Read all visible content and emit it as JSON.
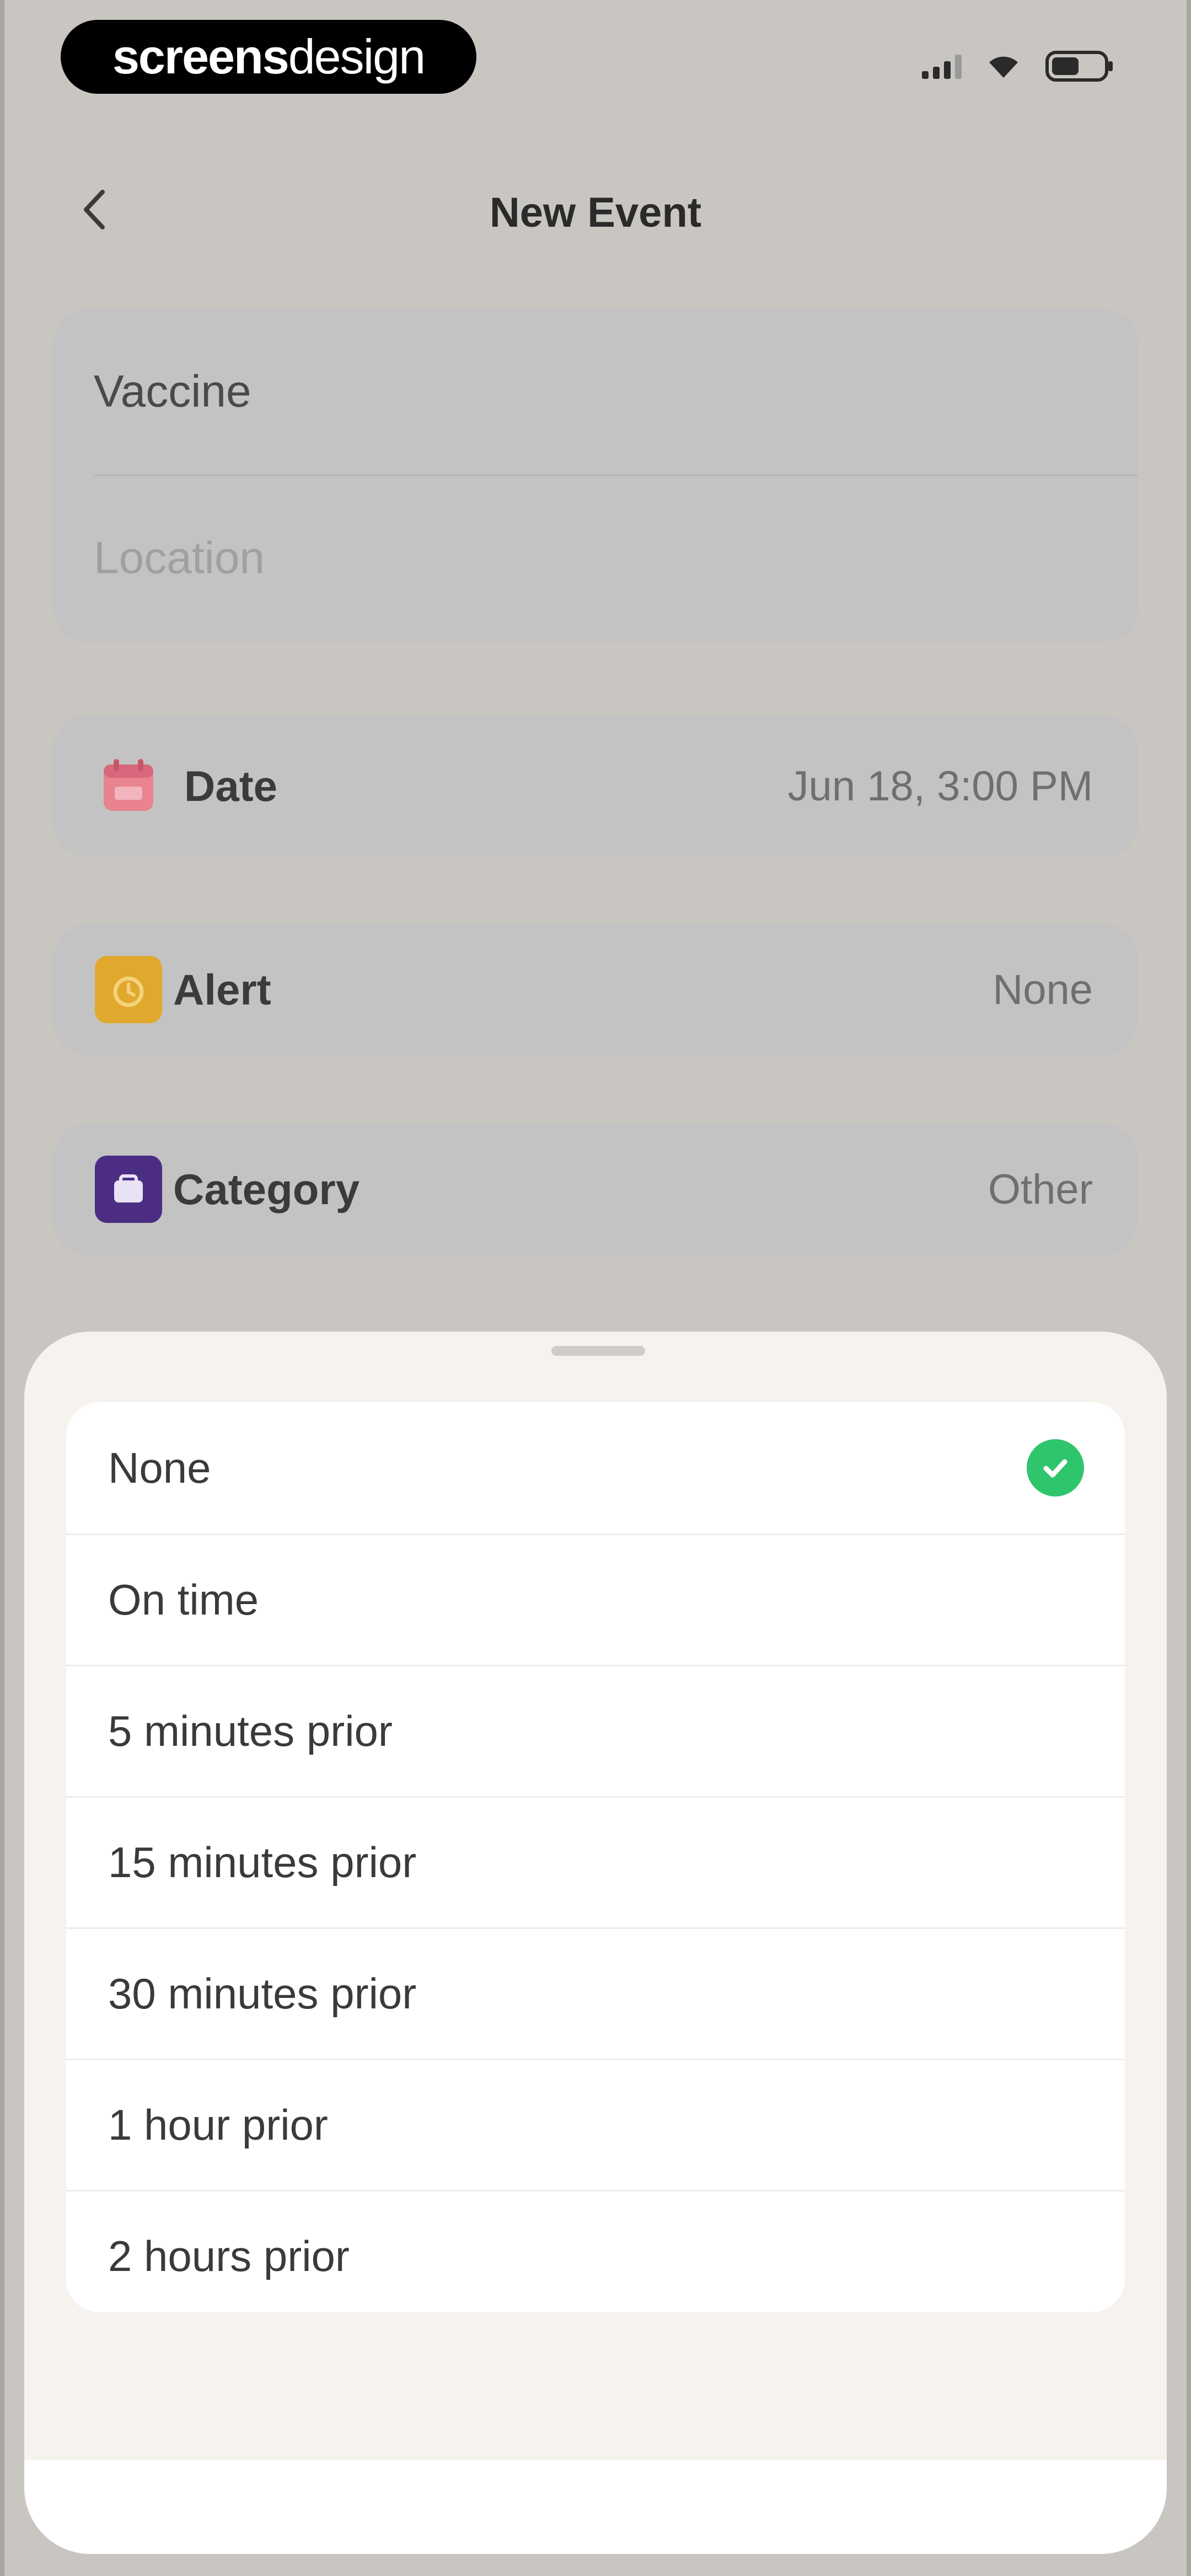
{
  "status_bar": {
    "brand_bold": "screens",
    "brand_light": "design",
    "icons": [
      "signal-icon",
      "wifi-icon",
      "battery-icon"
    ]
  },
  "nav": {
    "title": "New Event",
    "back_icon": "chevron-left-icon"
  },
  "fields": {
    "title_value": "Vaccine",
    "location_placeholder": "Location"
  },
  "rows": {
    "date": {
      "label": "Date",
      "value": "Jun 18, 3:00 PM",
      "icon": "calendar-icon",
      "icon_color": "#e8838f"
    },
    "alert": {
      "label": "Alert",
      "value": "None",
      "icon": "alarm-icon",
      "icon_color": "#e0a92e"
    },
    "category": {
      "label": "Category",
      "value": "Other",
      "icon": "folder-icon",
      "icon_color": "#4b2e83"
    }
  },
  "alert_sheet": {
    "options": [
      {
        "label": "None",
        "selected": true
      },
      {
        "label": "On time",
        "selected": false
      },
      {
        "label": "5 minutes prior",
        "selected": false
      },
      {
        "label": "15 minutes prior",
        "selected": false
      },
      {
        "label": "30 minutes prior",
        "selected": false
      },
      {
        "label": "1 hour prior",
        "selected": false
      },
      {
        "label": "2 hours prior",
        "selected": false
      }
    ],
    "check_icon": "checkmark-circle-icon",
    "check_color": "#2fc56d"
  }
}
